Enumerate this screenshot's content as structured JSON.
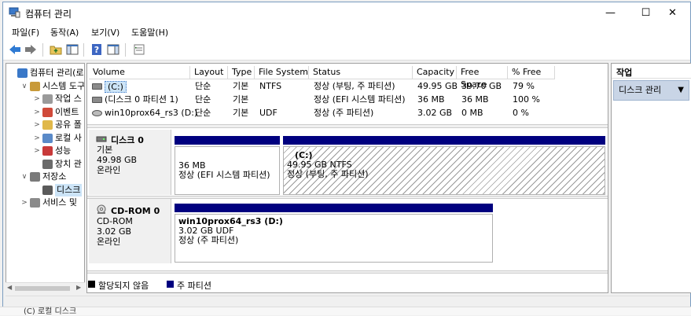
{
  "window": {
    "title": "컴퓨터 관리",
    "minimize_glyph": "—",
    "maximize_glyph": "☐",
    "close_glyph": "✕"
  },
  "background_text": {
    "top": "",
    "bottom": "(C) 로컬 디스크"
  },
  "menu": [
    "파일(F)",
    "동작(A)",
    "보기(V)",
    "도움말(H)"
  ],
  "toolbar": {
    "icons": [
      "back-arrow-icon",
      "forward-arrow-icon",
      "up-folder-icon",
      "show-hide-tree-icon",
      "help-icon",
      "view-pane-icon",
      "properties-icon"
    ]
  },
  "tree": {
    "items": [
      {
        "label": "컴퓨터 관리(로",
        "arrow": "",
        "indent": 0,
        "icon": "computer-management-icon"
      },
      {
        "label": "시스템 도구",
        "arrow": "∨",
        "indent": 1,
        "icon": "system-tools-icon"
      },
      {
        "label": "작업 스",
        "arrow": ">",
        "indent": 2,
        "icon": "task-scheduler-icon"
      },
      {
        "label": "이벤트",
        "arrow": ">",
        "indent": 2,
        "icon": "event-viewer-icon"
      },
      {
        "label": "공유 폴",
        "arrow": ">",
        "indent": 2,
        "icon": "shared-folders-icon"
      },
      {
        "label": "로컬 사",
        "arrow": ">",
        "indent": 2,
        "icon": "local-users-icon"
      },
      {
        "label": "성능",
        "arrow": ">",
        "indent": 2,
        "icon": "performance-icon"
      },
      {
        "label": "장치 관",
        "arrow": "",
        "indent": 2,
        "icon": "device-manager-icon"
      },
      {
        "label": "저장소",
        "arrow": "∨",
        "indent": 1,
        "icon": "storage-icon"
      },
      {
        "label": "디스크",
        "arrow": "",
        "indent": 2,
        "icon": "disk-management-icon",
        "selected": true
      },
      {
        "label": "서비스 및",
        "arrow": ">",
        "indent": 1,
        "icon": "services-icon"
      }
    ]
  },
  "volumes": {
    "headers": [
      "Volume",
      "Layout",
      "Type",
      "File System",
      "Status",
      "Capacity",
      "Free Space",
      "% Free"
    ],
    "rows": [
      {
        "volume": "(C:)",
        "layout": "단순",
        "type": "기본",
        "fs": "NTFS",
        "status": "정상 (부팅, 주 파티션)",
        "capacity": "49.95 GB",
        "free": "39.70 GB",
        "pct": "79 %",
        "selected": true
      },
      {
        "volume": "(디스크 0 파티션 1)",
        "layout": "단순",
        "type": "기본",
        "fs": "",
        "status": "정상 (EFI 시스템 파티션)",
        "capacity": "36 MB",
        "free": "36 MB",
        "pct": "100 %"
      },
      {
        "volume": "win10prox64_rs3 (D:)",
        "layout": "단순",
        "type": "기본",
        "fs": "UDF",
        "status": "정상 (주 파티션)",
        "capacity": "3.02 GB",
        "free": "0 MB",
        "pct": "0 %"
      }
    ]
  },
  "disks": [
    {
      "name": "디스크 0",
      "kind": "기본",
      "size": "49.98 GB",
      "state": "온라인",
      "partitions": [
        {
          "title": "",
          "line1": "36 MB",
          "line2": "정상 (EFI 시스템 파티션)"
        },
        {
          "title": "(C:)",
          "line1": "49.95 GB NTFS",
          "line2": "정상 (부팅, 주 파티션)"
        }
      ]
    },
    {
      "name": "CD-ROM 0",
      "kind": "CD-ROM",
      "size": "3.02 GB",
      "state": "온라인",
      "partitions": [
        {
          "title": "win10prox64_rs3  (D:)",
          "line1": "3.02 GB UDF",
          "line2": "정상 (주 파티션)"
        }
      ]
    }
  ],
  "legend": {
    "unallocated": "할당되지 않음",
    "primary": "주 파티션",
    "unallocated_color": "#000000",
    "primary_color": "#00007f"
  },
  "actions": {
    "header": "작업",
    "item": "디스크 관리",
    "arrow": "▼"
  }
}
